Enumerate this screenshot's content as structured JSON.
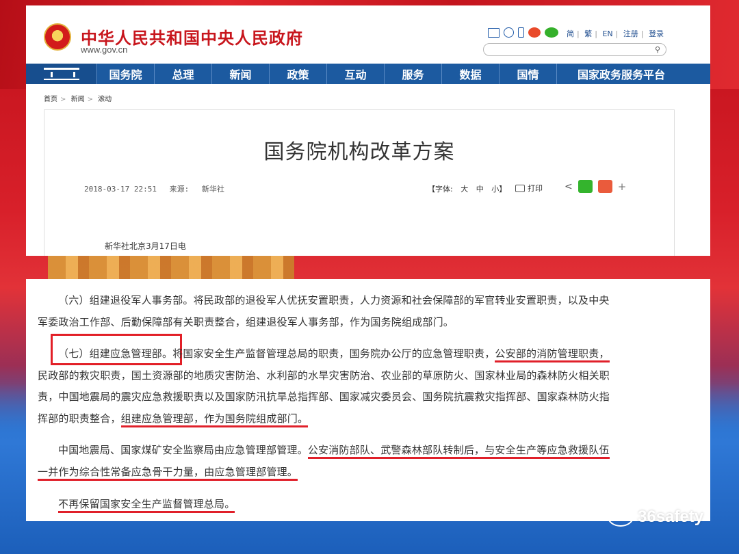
{
  "header": {
    "site_title": "中华人民共和国中央人民政府",
    "site_url": "www.gov.cn",
    "links": [
      "简",
      "繁",
      "EN",
      "注册",
      "登录"
    ]
  },
  "nav": {
    "items": [
      "国务院",
      "总理",
      "新闻",
      "政策",
      "互动",
      "服务",
      "数据",
      "国情",
      "国家政务服务平台"
    ]
  },
  "breadcrumb": [
    "首页",
    "新闻",
    "滚动"
  ],
  "article": {
    "title": "国务院机构改革方案",
    "date": "2018-03-17 22:51",
    "source_label": "来源:",
    "source": "新华社",
    "font_label": "【字体:",
    "font_sizes": [
      "大",
      "中",
      "小】"
    ],
    "print_label": "打印",
    "dateline": "新华社北京3月17日电"
  },
  "document": {
    "p1_line1": "（六）组建退役军人事务部。将民政部的退役军人优抚安置职责，人力资源和社会保障部的军官转业安置职责，以及中央",
    "p1_line2": "军委政治工作部、后勤保障部有关职责整合，组建退役军人事务部，作为国务院组成部门。",
    "p2_a": "（七）组建应急管理部。",
    "p2_b": "将国家安全生产监督管理总局的职责，国务院办公厅的应急管理职责，",
    "p2_c": "公安部的消防管理职责，",
    "p2_line2": "民政部的救灾职责，国土资源部的地质灾害防治、水利部的水旱灾害防治、农业部的草原防火、国家林业局的森林防火相关职",
    "p2_line3": "责，中国地震局的震灾应急救援职责以及国家防汛抗旱总指挥部、国家减灾委员会、国务院抗震救灾指挥部、国家森林防火指",
    "p2_line4a": "挥部的职责整合，",
    "p2_line4b": "组建应急管理部，作为国务院组成部门。",
    "p3_a": "中国地震局、国家煤矿安全监察局由应急管理部管理。",
    "p3_b": "公安消防部队、武警森林部队转制后，与安全生产等应急救援队伍",
    "p3_line2": "一并作为综合性常备应急骨干力量，由应急管理部管理。",
    "p4": "不再保留国家安全生产监督管理总局。"
  },
  "watermark": "36safety",
  "colors": {
    "brand_red": "#c8161d",
    "nav_blue": "#1c5aa0",
    "highlight_red": "#e0202a"
  },
  "icons": [
    "mail-icon",
    "chat-icon",
    "phone-icon",
    "weibo-icon",
    "wechat-icon",
    "search-icon",
    "printer-icon",
    "share-icon",
    "plus-icon"
  ]
}
